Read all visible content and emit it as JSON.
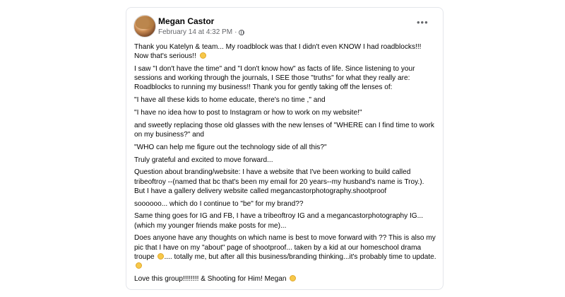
{
  "post": {
    "author": "Megan Castor",
    "timestamp": "February 14 at 4:32 PM",
    "separator": "·",
    "privacy_icon": "globe-icon",
    "more_icon": "more-options-icon",
    "more_label": "•••",
    "paragraphs": [
      "Thank you Katelyn & team... My roadblock was that I didn't even KNOW I had roadblocks!!! Now that's serious!!",
      "I saw \"I don't have the time\" and \"I don't know how\" as facts of life.  Since listening to your sessions and working through the journals,  I SEE those \"truths\" for what they really are: Roadblocks to running my business!!  Thank you for gently taking off the lenses of:",
      "\"I have all these kids to home educate, there's no time ,\" and",
      "\"I have no idea how to post to Instagram or how to work on my website!\"",
      "and sweetly replacing those old glasses with the new lenses of \"WHERE can I find time to work on my business?\" and",
      "\"WHO can help me figure out the technology side of all this?\"",
      "Truly grateful and excited to move forward...",
      "Question about branding/website: I have a website that I've been working to build called tribeoftroy --(named that bc that's been my email for 20 years--my husband's name is Troy.). But I have a gallery delivery website called megancastorphotography.shootproof",
      "soooooo... which do I continue to \"be\" for my brand??",
      "Same thing goes for IG and FB, I have a tribeoftroy IG and a megancastorphotography IG... (which my younger friends make posts for me)...",
      "Does anyone have any thoughts on which name is best to move forward with ??   This is also my pic that I have on my \"about\" page of shootproof... taken by a kid at our homeschool drama troupe",
      "Love this group!!!!!!!!  & Shooting for Him!  Megan"
    ],
    "p11_tail_a": "....  totally me, but after all this business/branding thinking...it's probably time to update.",
    "colors": {
      "text": "#050505",
      "meta": "#65676b",
      "border": "#e4e6eb"
    }
  }
}
